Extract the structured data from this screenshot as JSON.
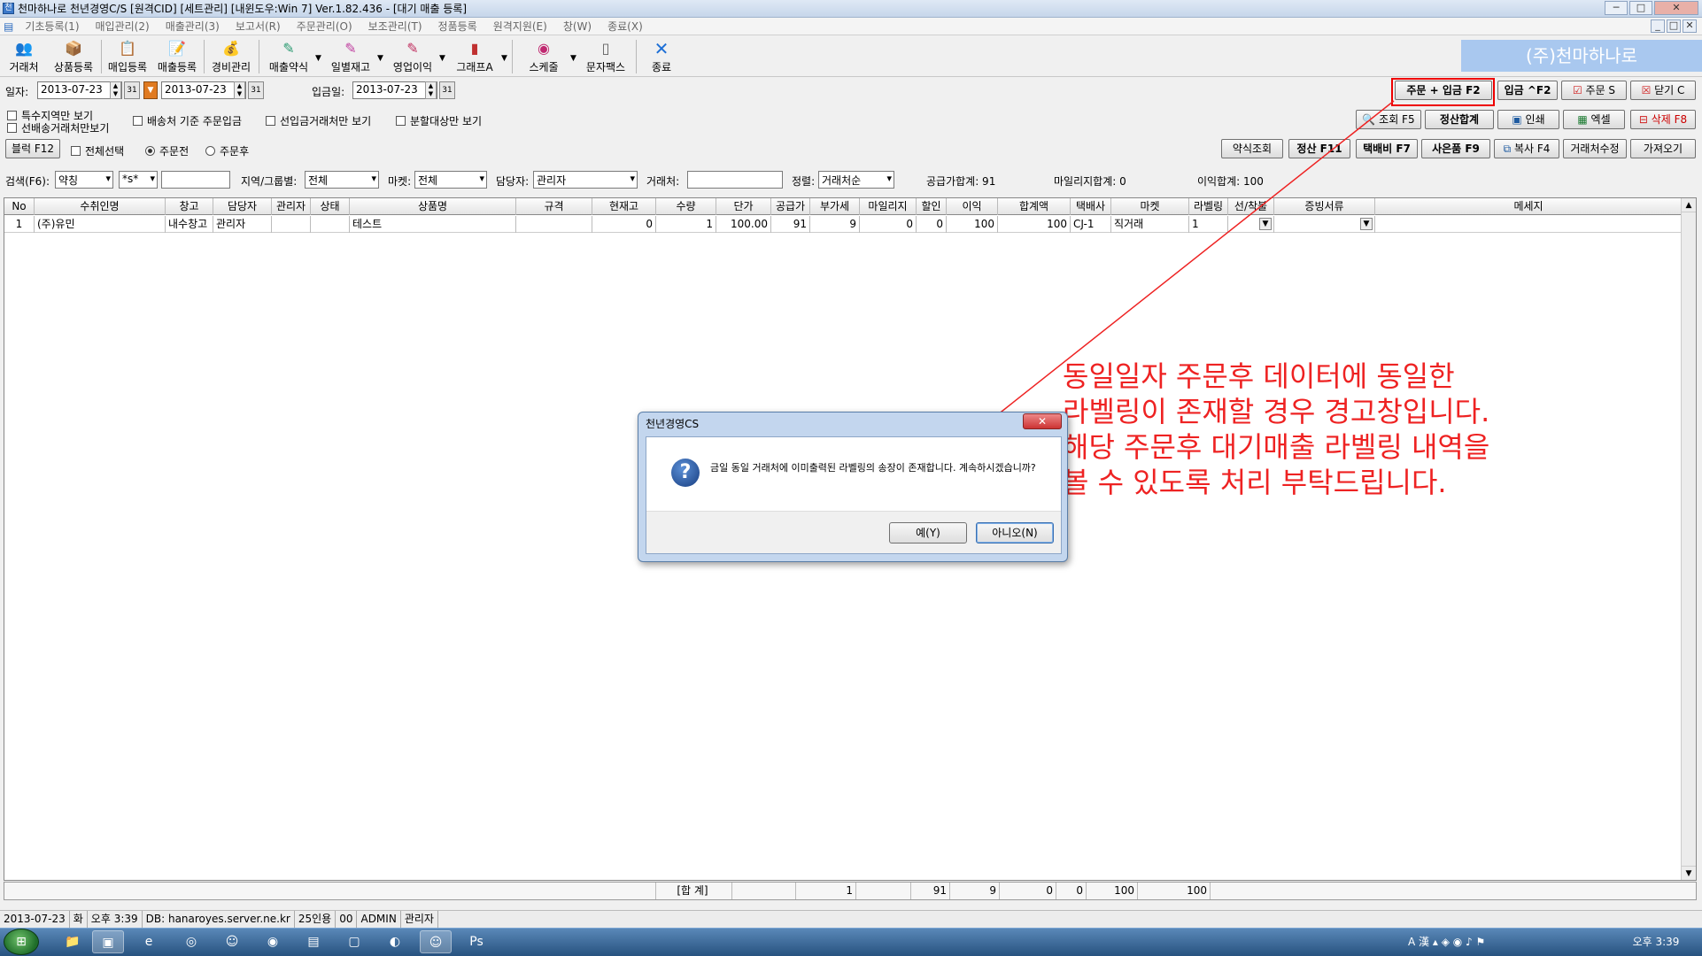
{
  "window": {
    "title": "천마하나로 천년경영C/S [원격CID] [세트관리] [내윈도우:Win 7] Ver.1.82.436 - [대기 매출 등록]",
    "min": "─",
    "max": "□",
    "close": "✕",
    "inner_min": "_",
    "inner_max": "□",
    "inner_close": "✕"
  },
  "menu": [
    "기초등록(1)",
    "매입관리(2)",
    "매출관리(3)",
    "보고서(R)",
    "주문관리(O)",
    "보조관리(T)",
    "정품등록",
    "원격지원(E)",
    "창(W)",
    "종료(X)"
  ],
  "toolbar": {
    "items": [
      {
        "label": "거래처",
        "icon": "handshake-icon",
        "glyph": "👥"
      },
      {
        "label": "상품등록",
        "icon": "box-icon",
        "glyph": "📦"
      },
      {
        "label": "매입등록",
        "icon": "purchase-icon",
        "glyph": "📋"
      },
      {
        "label": "매출등록",
        "icon": "sales-icon",
        "glyph": "📝"
      },
      {
        "label": "경비관리",
        "icon": "coins-icon",
        "glyph": "💰"
      },
      {
        "label": "매출약식",
        "icon": "sales-simple-icon",
        "glyph": "✎"
      },
      {
        "label": "일별재고",
        "icon": "stock-icon",
        "glyph": "✎"
      },
      {
        "label": "영업이익",
        "icon": "profit-icon",
        "glyph": "✎"
      },
      {
        "label": "그래프A",
        "icon": "bar-chart-icon",
        "glyph": "▮"
      },
      {
        "label": "스케줄",
        "icon": "schedule-icon",
        "glyph": "◉"
      },
      {
        "label": "문자팩스",
        "icon": "phone-icon",
        "glyph": "▯"
      },
      {
        "label": "종료",
        "icon": "close-x-icon",
        "glyph": "✕"
      }
    ],
    "brand": "(주)천마하나로"
  },
  "filters": {
    "date_label": "일자:",
    "date_from": "2013-07-23",
    "date_to": "2013-07-23",
    "deposit_label": "입금일:",
    "deposit_date": "2013-07-23",
    "cb_special_region": "특수지역만 보기",
    "cb_prepaid": "선배송거래처만보기",
    "cb_ship_base": "배송처 기준 주문입금",
    "cb_prepay_vendor": "선입금거래처만 보기",
    "cb_split": "분할대상만 보기",
    "block_btn": "블럭 F12",
    "cb_select_all": "전체선택",
    "rb_before": "주문전",
    "rb_after": "주문후",
    "search_label": "검색(F6):",
    "search_field": "약칭",
    "search_op": "*s*",
    "search_value": "",
    "region_label": "지역/그룹별:",
    "region_value": "전체",
    "market_label": "마켓:",
    "market_value": "전체",
    "manager_label": "담당자:",
    "manager_value": "관리자",
    "vendor_label": "거래처:",
    "vendor_value": "",
    "sort_label": "정렬:",
    "sort_value": "거래처순",
    "sum_supply": "공급가합계: 91",
    "sum_mileage": "마일리지합계: 0",
    "sum_profit": "이익합계: 100"
  },
  "buttons": {
    "order_deposit": "주문 + 입금 F2",
    "deposit": "입금 ^F2",
    "order": "주문 S",
    "close": "닫기 C",
    "query": "조회 F5",
    "settle_total": "정산합계",
    "print": "인쇄",
    "excel": "엑셀",
    "delete": "삭제 F8",
    "simple_query": "약식조회",
    "settle": "정산 F11",
    "delivery": "택배비 F7",
    "gift": "사은품 F9",
    "copy": "복사 F4",
    "edit_vendor": "거래처수정",
    "import": "가져오기"
  },
  "grid": {
    "columns": [
      "No",
      "수취인명",
      "창고",
      "담당자",
      "관리자",
      "상태",
      "상품명",
      "규격",
      "현재고",
      "수량",
      "단가",
      "공급가",
      "부가세",
      "마일리지",
      "할인",
      "이익",
      "합계액",
      "택배사",
      "마켓",
      "라벨링",
      "선/착불",
      "증빙서류",
      "메세지"
    ],
    "rows": [
      {
        "no": "1",
        "name": "(주)유민",
        "warehouse": "내수창고",
        "manager": "관리자",
        "admin": "",
        "state": "",
        "product": "테스트",
        "spec": "",
        "stock": "0",
        "qty": "1",
        "price": "100.00",
        "supply": "91",
        "vat": "9",
        "mileage": "0",
        "discount": "0",
        "profit": "100",
        "total": "100",
        "courier": "CJ-1",
        "market": "직거래",
        "label": "1",
        "paytype": "",
        "proof": "",
        "message": ""
      }
    ],
    "totals": {
      "label": "[합 계]",
      "qty": "1",
      "supply": "91",
      "vat": "9",
      "mileage": "0",
      "discount": "0",
      "profit": "100",
      "total": "100"
    }
  },
  "statusbar": [
    "2013-07-23",
    "화",
    "오후 3:39",
    "DB: hanaroyes.server.ne.kr",
    "25인용",
    "00",
    "ADMIN",
    "관리자"
  ],
  "taskbar": {
    "clock": "오후 3:39",
    "ime": "A 漢"
  },
  "dialog": {
    "title": "천년경영CS",
    "close": "✕",
    "message": "금일 동일 거래처에 이미출력된 라벨링의 송장이 존재합니다. 계속하시겠습니까?",
    "yes": "예(Y)",
    "no": "아니오(N)"
  },
  "annotation": {
    "line1": "동일일자 주문후 데이터에 동일한",
    "line2": "라벨링이 존재할 경우 경고창입니다.",
    "line3": "해당 주문후 대기매출 라벨링 내역을",
    "line4": "볼 수 있도록 처리 부탁드립니다."
  },
  "colors": {
    "annotation": "#ee2222",
    "brand_bg": "#a9c8ef"
  }
}
